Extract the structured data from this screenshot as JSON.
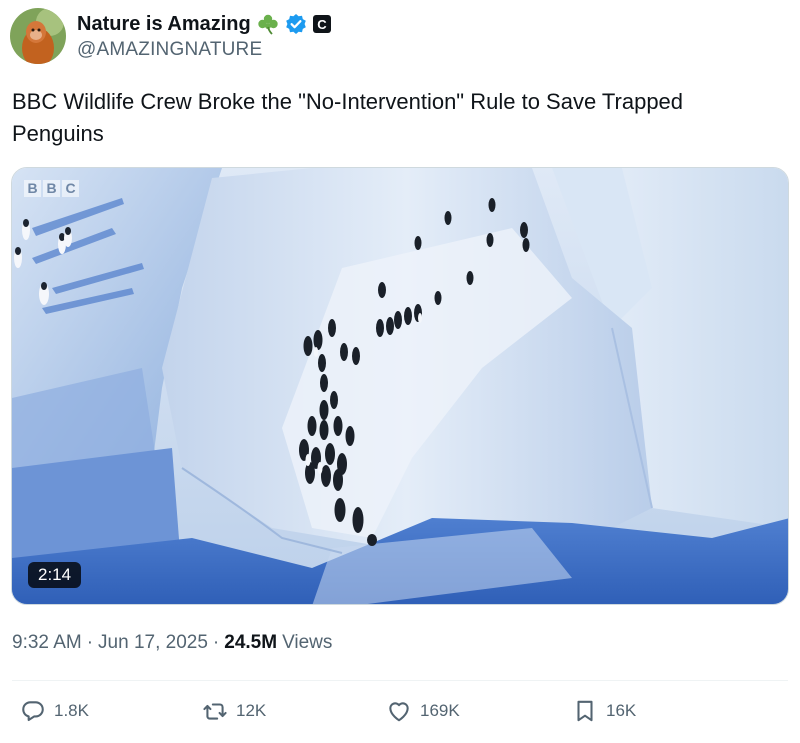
{
  "author": {
    "display_name": "Nature is Amazing",
    "handle": "@AMAZINGNATURE",
    "emoji": "shamrock-icon",
    "verified_color": "#1d9bf0",
    "affiliate_badge": "C"
  },
  "tweet": {
    "text": "BBC Wildlife Crew Broke the \"No-Intervention\" Rule to Save Trapped Penguins"
  },
  "media": {
    "watermark": [
      "B",
      "B",
      "C"
    ],
    "duration": "2:14"
  },
  "meta": {
    "time": "9:32 AM",
    "separator": "·",
    "date": "Jun 17, 2025",
    "views_count": "24.5M",
    "views_label": "Views"
  },
  "actions": {
    "replies": "1.8K",
    "reposts": "12K",
    "likes": "169K",
    "bookmarks": "16K"
  },
  "colors": {
    "text_primary": "#0f1419",
    "text_secondary": "#536471",
    "accent": "#1d9bf0",
    "shamrock": "#6ab04c"
  }
}
